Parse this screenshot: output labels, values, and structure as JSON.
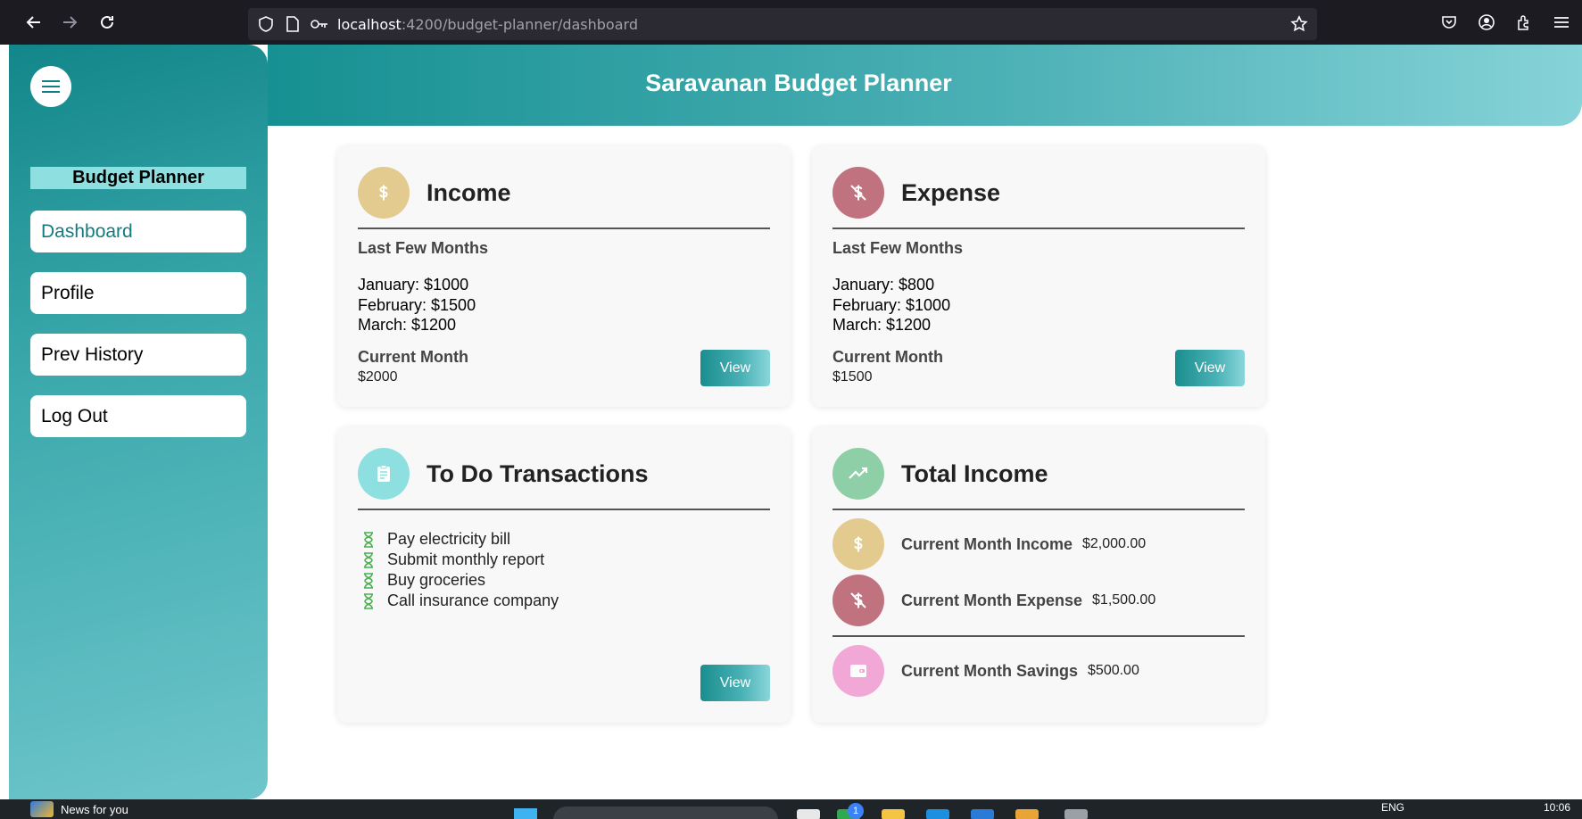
{
  "browser": {
    "url_host": "localhost",
    "url_path": ":4200/budget-planner/dashboard"
  },
  "app": {
    "title": "Saravanan Budget Planner"
  },
  "sidebar": {
    "title": "Budget Planner",
    "items": [
      {
        "label": "Dashboard",
        "active": true
      },
      {
        "label": "Profile"
      },
      {
        "label": "Prev History"
      },
      {
        "label": "Log Out"
      }
    ]
  },
  "income": {
    "title": "Income",
    "subhead": "Last Few Months",
    "months": [
      "January: $1000",
      "February: $1500",
      "March: $1200"
    ],
    "current_label": "Current Month",
    "current_value": "$2000",
    "view_label": "View",
    "icon": "dollar-icon",
    "color": "#e3cb8f"
  },
  "expense": {
    "title": "Expense",
    "subhead": "Last Few Months",
    "months": [
      "January: $800",
      "February: $1000",
      "March: $1200"
    ],
    "current_label": "Current Month",
    "current_value": "$1500",
    "view_label": "View",
    "icon": "money-off-icon",
    "color": "#c0737f"
  },
  "todo": {
    "title": "To Do Transactions",
    "items": [
      "Pay electricity bill",
      "Submit monthly report",
      "Buy groceries",
      "Call insurance company"
    ],
    "view_label": "View",
    "icon": "clipboard-icon",
    "color": "#8ee0e0"
  },
  "total": {
    "title": "Total Income",
    "icon": "trending-up-icon",
    "color": "#8fcfa8",
    "rows": [
      {
        "label": "Current Month Income",
        "value": "$2,000.00"
      },
      {
        "label": "Current Month Expense",
        "value": "$1,500.00"
      },
      {
        "label": "Current Month Savings",
        "value": "$500.00"
      }
    ]
  },
  "taskbar": {
    "news": "News for you",
    "badge": "1",
    "lang": "ENG",
    "time": "10:06"
  }
}
